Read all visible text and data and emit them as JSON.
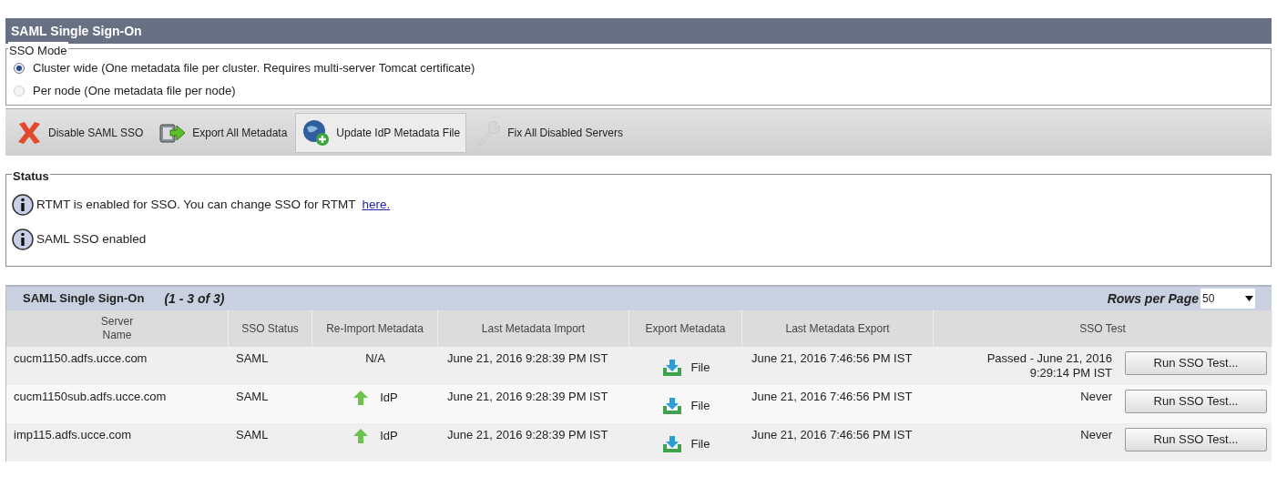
{
  "header": {
    "title": "SAML Single Sign-On"
  },
  "sso_mode": {
    "legend": "SSO Mode",
    "options": [
      {
        "label": "Cluster wide (One metadata file per cluster. Requires multi-server Tomcat certificate)",
        "selected": true
      },
      {
        "label": "Per node (One metadata file per node)",
        "selected": false
      }
    ]
  },
  "toolbar": [
    {
      "kind": "disable",
      "label": "Disable SAML SSO",
      "selected": false,
      "disabled": false
    },
    {
      "kind": "export",
      "label": "Export All Metadata",
      "selected": false,
      "disabled": false
    },
    {
      "kind": "update",
      "label": "Update IdP Metadata File",
      "selected": true,
      "disabled": false
    },
    {
      "kind": "fix",
      "label": "Fix All Disabled Servers",
      "selected": false,
      "disabled": true
    }
  ],
  "status": {
    "legend": "Status",
    "messages": [
      {
        "text": "RTMT is enabled for SSO. You can change SSO for RTMT",
        "link": "here."
      },
      {
        "text": "SAML SSO enabled"
      }
    ]
  },
  "table": {
    "title": "SAML Single Sign-On",
    "range": "(1 - 3 of 3)",
    "rows_per_page_label": "Rows per Page",
    "rows_per_page": "50",
    "columns": [
      "Server Name",
      "SSO Status",
      "Re-Import Metadata",
      "Last Metadata Import",
      "Export Metadata",
      "Last Metadata Export",
      "SSO Test"
    ],
    "rows": [
      {
        "server_name": "cucm1150.adfs.ucce.com",
        "sso_status": "SAML",
        "reimport": {
          "kind": "text",
          "label": "N/A"
        },
        "last_import": "June 21, 2016 9:28:39 PM IST",
        "export": "File",
        "last_export": "June 21, 2016 7:46:56 PM IST",
        "sso_test": "Passed - June 21, 2016 9:29:14 PM IST",
        "button": "Run SSO Test..."
      },
      {
        "server_name": "cucm1150sub.adfs.ucce.com",
        "sso_status": "SAML",
        "reimport": {
          "kind": "link",
          "label": "IdP"
        },
        "last_import": "June 21, 2016 9:28:39 PM IST",
        "export": "File",
        "last_export": "June 21, 2016 7:46:56 PM IST",
        "sso_test": "Never",
        "button": "Run SSO Test..."
      },
      {
        "server_name": "imp115.adfs.ucce.com",
        "sso_status": "SAML",
        "reimport": {
          "kind": "link",
          "label": "IdP"
        },
        "last_import": "June 21, 2016 9:28:39 PM IST",
        "export": "File",
        "last_export": "June 21, 2016 7:46:56 PM IST",
        "sso_test": "Never",
        "button": "Run SSO Test..."
      }
    ]
  }
}
